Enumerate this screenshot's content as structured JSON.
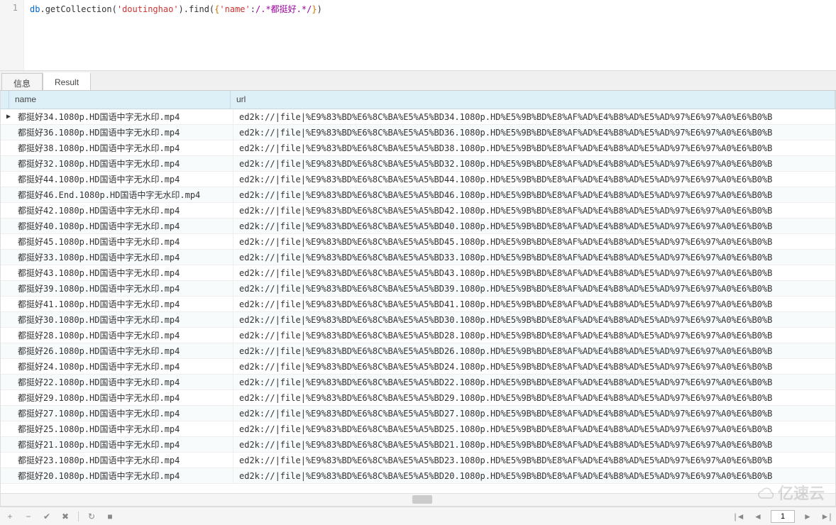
{
  "editor": {
    "line_no": "1",
    "tokens": {
      "db": "db",
      "dot1": ".",
      "get_collection": "getCollection",
      "lp1": "(",
      "arg1": "'doutinghao'",
      "rp1": ")",
      "dot2": ".",
      "find": "find",
      "lp2": "(",
      "lbr": "{",
      "key": "'name'",
      "colon": ":",
      "regex": "/.*都挺好.*/",
      "rbr": "}",
      "rp2": ")"
    }
  },
  "tabs": {
    "info": "信息",
    "result": "Result"
  },
  "columns": {
    "name": "name",
    "url": "url"
  },
  "url_prefix": "ed2k://|file|%E9%83%BD%E6%8C%BA%E5%A5%BD",
  "url_suffix": ".1080p.HD%E5%9B%BD%E8%AF%AD%E4%B8%AD%E5%AD%97%E6%97%A0%E6%B0%B",
  "name_prefix": "都挺好",
  "name_mid": ".1080p.HD国语中字无水印.mp4",
  "end_name": "都挺好46.End.1080p.HD国语中字无水印.mp4",
  "rows": [
    {
      "ep": "34",
      "marker": "▶"
    },
    {
      "ep": "36"
    },
    {
      "ep": "38"
    },
    {
      "ep": "32"
    },
    {
      "ep": "44"
    },
    {
      "ep": "46",
      "end": true
    },
    {
      "ep": "42"
    },
    {
      "ep": "40"
    },
    {
      "ep": "45"
    },
    {
      "ep": "33"
    },
    {
      "ep": "43"
    },
    {
      "ep": "39"
    },
    {
      "ep": "41"
    },
    {
      "ep": "30"
    },
    {
      "ep": "28"
    },
    {
      "ep": "26"
    },
    {
      "ep": "24"
    },
    {
      "ep": "22"
    },
    {
      "ep": "29"
    },
    {
      "ep": "27"
    },
    {
      "ep": "25"
    },
    {
      "ep": "21"
    },
    {
      "ep": "23"
    },
    {
      "ep": "20"
    }
  ],
  "footer": {
    "add": "+",
    "remove": "−",
    "confirm": "✔",
    "cancel": "✖",
    "refresh": "↻",
    "stop": "■",
    "first": "|◄",
    "prev": "◄",
    "page": "1",
    "next": "►",
    "last": "►|"
  },
  "watermark": "亿速云"
}
